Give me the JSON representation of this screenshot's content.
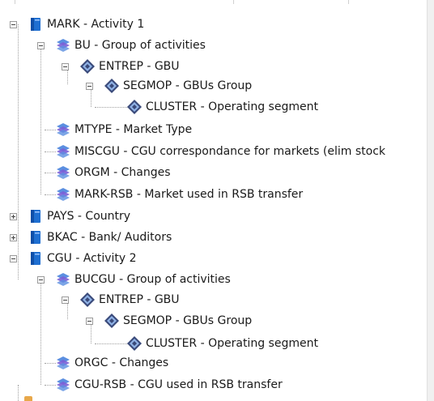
{
  "tree": {
    "nodes": [
      {
        "label": "MARK - Activity 1",
        "icon": "dimension-book-icon",
        "toggle": "minus"
      },
      {
        "label": "BU - Group of activities",
        "icon": "hierarchy-link-icon",
        "toggle": "minus"
      },
      {
        "label": "ENTREP - GBU",
        "icon": "diamond-level-icon",
        "toggle": "minus"
      },
      {
        "label": "SEGMOP - GBUs Group",
        "icon": "diamond-level-icon",
        "toggle": "minus"
      },
      {
        "label": "CLUSTER - Operating segment",
        "icon": "diamond-level-icon",
        "toggle": "none"
      },
      {
        "label": "MTYPE - Market Type",
        "icon": "hierarchy-link-icon",
        "toggle": "none"
      },
      {
        "label": "MISCGU - CGU correspondance for markets (elim stock",
        "icon": "hierarchy-link-icon",
        "toggle": "none"
      },
      {
        "label": "ORGM - Changes",
        "icon": "hierarchy-link-icon",
        "toggle": "none"
      },
      {
        "label": "MARK-RSB - Market used in RSB transfer",
        "icon": "hierarchy-link-icon",
        "toggle": "none"
      },
      {
        "label": "PAYS - Country",
        "icon": "dimension-book-icon",
        "toggle": "plus"
      },
      {
        "label": "BKAC - Bank/ Auditors",
        "icon": "dimension-book-icon",
        "toggle": "plus"
      },
      {
        "label": "CGU - Activity 2",
        "icon": "dimension-book-icon",
        "toggle": "minus"
      },
      {
        "label": "BUCGU - Group of activities",
        "icon": "hierarchy-link-icon",
        "toggle": "minus"
      },
      {
        "label": "ENTREP - GBU",
        "icon": "diamond-level-icon",
        "toggle": "minus"
      },
      {
        "label": "SEGMOP - GBUs Group",
        "icon": "diamond-level-icon",
        "toggle": "minus"
      },
      {
        "label": "CLUSTER - Operating segment",
        "icon": "diamond-level-icon",
        "toggle": "none"
      },
      {
        "label": "ORGC - Changes",
        "icon": "hierarchy-link-icon",
        "toggle": "none"
      },
      {
        "label": "CGU-RSB - CGU used in RSB transfer",
        "icon": "hierarchy-link-icon",
        "toggle": "none"
      }
    ]
  },
  "colors": {
    "book_blue": "#1f6fd1",
    "link_blue": "#5b8fe0",
    "link_purple": "#7b5fd6",
    "diamond_dark": "#3a4a7a",
    "diamond_light": "#8fb2e6"
  }
}
